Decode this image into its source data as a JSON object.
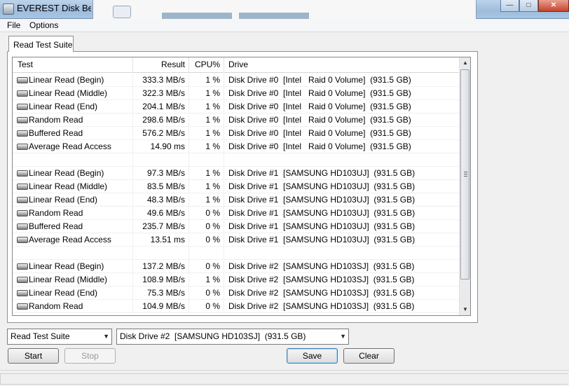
{
  "window": {
    "title": "EVEREST Disk Bench"
  },
  "menu": {
    "file": "File",
    "options": "Options"
  },
  "tab": {
    "label": "Read Test Suite"
  },
  "columns": {
    "test": "Test",
    "result": "Result",
    "cpu": "CPU%",
    "drive": "Drive"
  },
  "rows": [
    {
      "test": "Linear Read (Begin)",
      "result": "333.3 MB/s",
      "cpu": "1 %",
      "drive": "Disk Drive #0  [Intel   Raid 0 Volume]  (931.5 GB)"
    },
    {
      "test": "Linear Read (Middle)",
      "result": "322.3 MB/s",
      "cpu": "1 %",
      "drive": "Disk Drive #0  [Intel   Raid 0 Volume]  (931.5 GB)"
    },
    {
      "test": "Linear Read (End)",
      "result": "204.1 MB/s",
      "cpu": "1 %",
      "drive": "Disk Drive #0  [Intel   Raid 0 Volume]  (931.5 GB)"
    },
    {
      "test": "Random Read",
      "result": "298.6 MB/s",
      "cpu": "1 %",
      "drive": "Disk Drive #0  [Intel   Raid 0 Volume]  (931.5 GB)"
    },
    {
      "test": "Buffered Read",
      "result": "576.2 MB/s",
      "cpu": "1 %",
      "drive": "Disk Drive #0  [Intel   Raid 0 Volume]  (931.5 GB)"
    },
    {
      "test": "Average Read Access",
      "result": "14.90 ms",
      "cpu": "1 %",
      "drive": "Disk Drive #0  [Intel   Raid 0 Volume]  (931.5 GB)"
    },
    {
      "test": "",
      "result": "",
      "cpu": "",
      "drive": ""
    },
    {
      "test": "Linear Read (Begin)",
      "result": "97.3 MB/s",
      "cpu": "1 %",
      "drive": "Disk Drive #1  [SAMSUNG HD103UJ]  (931.5 GB)"
    },
    {
      "test": "Linear Read (Middle)",
      "result": "83.5 MB/s",
      "cpu": "1 %",
      "drive": "Disk Drive #1  [SAMSUNG HD103UJ]  (931.5 GB)"
    },
    {
      "test": "Linear Read (End)",
      "result": "48.3 MB/s",
      "cpu": "1 %",
      "drive": "Disk Drive #1  [SAMSUNG HD103UJ]  (931.5 GB)"
    },
    {
      "test": "Random Read",
      "result": "49.6 MB/s",
      "cpu": "0 %",
      "drive": "Disk Drive #1  [SAMSUNG HD103UJ]  (931.5 GB)"
    },
    {
      "test": "Buffered Read",
      "result": "235.7 MB/s",
      "cpu": "0 %",
      "drive": "Disk Drive #1  [SAMSUNG HD103UJ]  (931.5 GB)"
    },
    {
      "test": "Average Read Access",
      "result": "13.51 ms",
      "cpu": "0 %",
      "drive": "Disk Drive #1  [SAMSUNG HD103UJ]  (931.5 GB)"
    },
    {
      "test": "",
      "result": "",
      "cpu": "",
      "drive": ""
    },
    {
      "test": "Linear Read (Begin)",
      "result": "137.2 MB/s",
      "cpu": "0 %",
      "drive": "Disk Drive #2  [SAMSUNG HD103SJ]  (931.5 GB)"
    },
    {
      "test": "Linear Read (Middle)",
      "result": "108.9 MB/s",
      "cpu": "1 %",
      "drive": "Disk Drive #2  [SAMSUNG HD103SJ]  (931.5 GB)"
    },
    {
      "test": "Linear Read (End)",
      "result": "75.3 MB/s",
      "cpu": "0 %",
      "drive": "Disk Drive #2  [SAMSUNG HD103SJ]  (931.5 GB)"
    },
    {
      "test": "Random Read",
      "result": "104.9 MB/s",
      "cpu": "0 %",
      "drive": "Disk Drive #2  [SAMSUNG HD103SJ]  (931.5 GB)"
    }
  ],
  "controls": {
    "suite_select": "Read Test Suite",
    "drive_select": "Disk Drive #2  [SAMSUNG HD103SJ]  (931.5 GB)",
    "start": "Start",
    "stop": "Stop",
    "save": "Save",
    "clear": "Clear"
  }
}
